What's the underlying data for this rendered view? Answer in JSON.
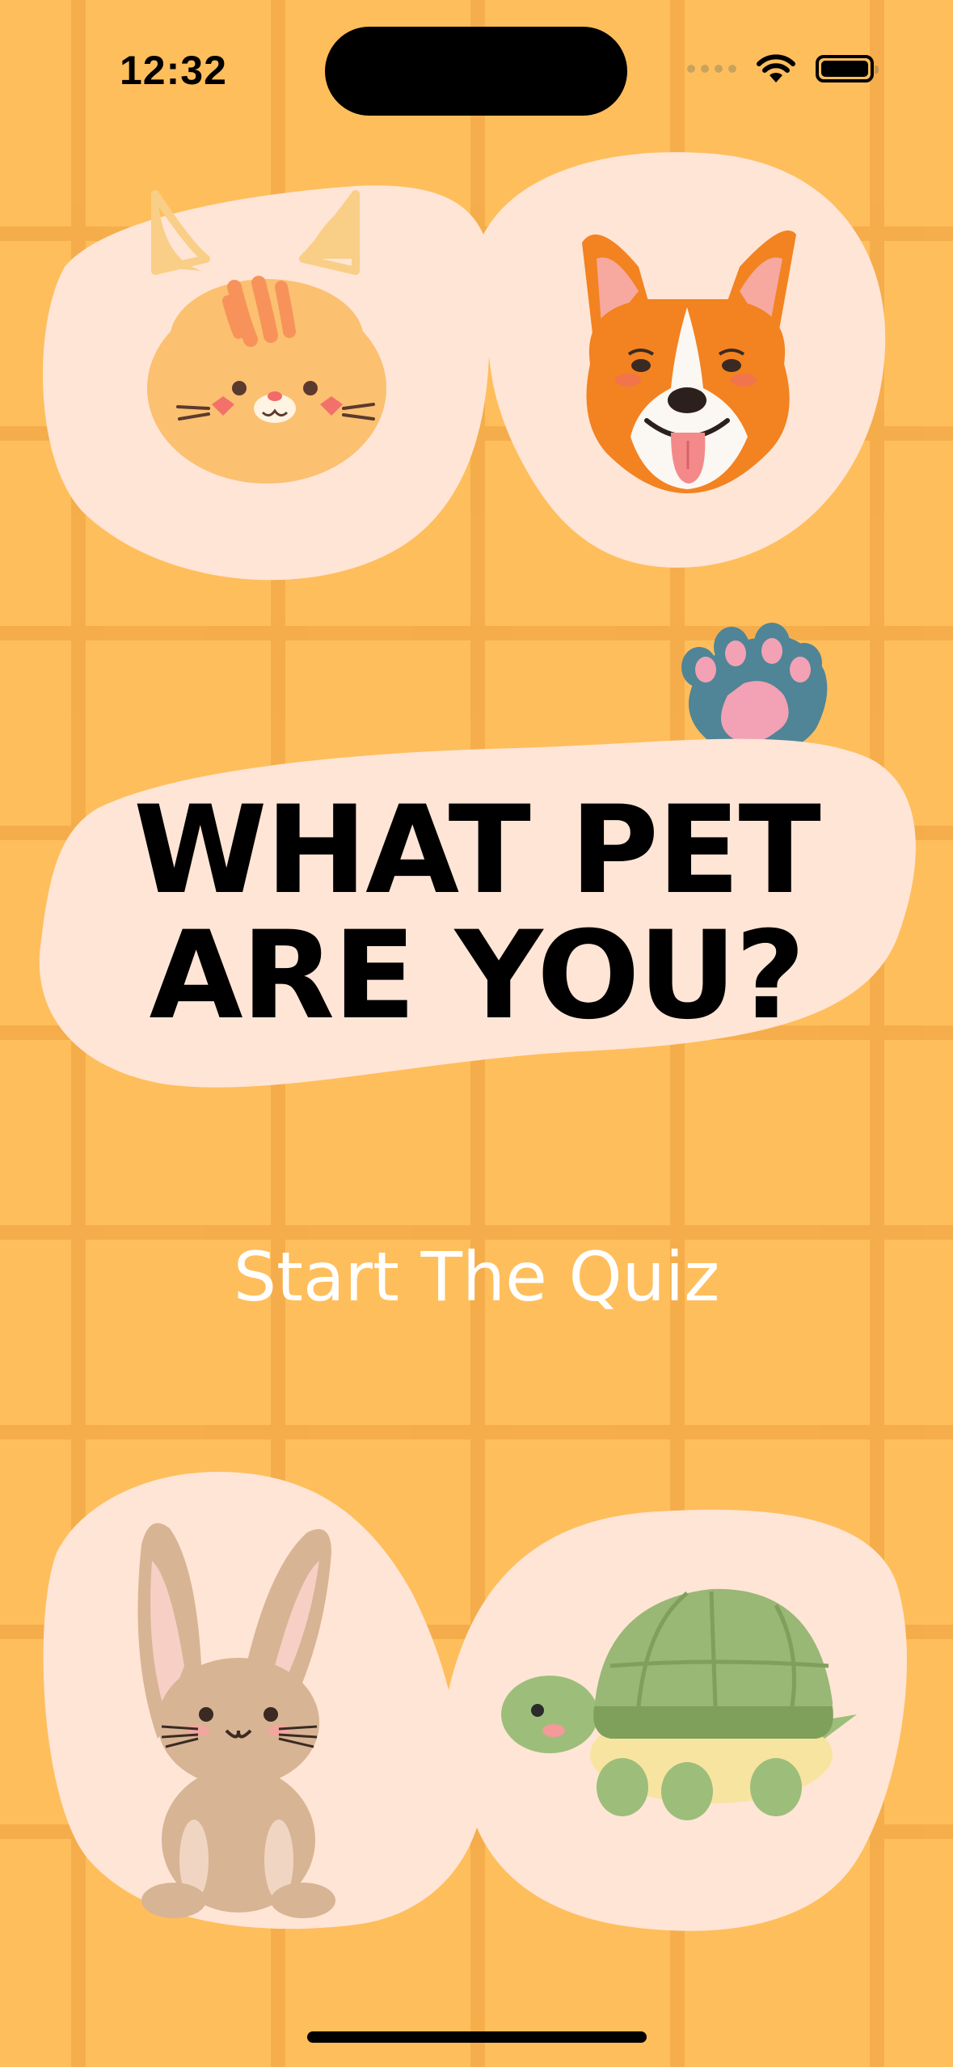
{
  "status_bar": {
    "time": "12:32",
    "icons": [
      "signal-dots-icon",
      "wifi-icon",
      "battery-icon"
    ]
  },
  "quiz": {
    "title_line1": "WHAT PET",
    "title_line2": "ARE YOU?",
    "cta_label": "Start The Quiz"
  },
  "illustrations": [
    "cat-icon",
    "corgi-dog-icon",
    "paw-print-icon",
    "rabbit-icon",
    "turtle-icon"
  ],
  "colors": {
    "background": "#FFBE5C",
    "grid_lines": "#F5AC4A",
    "blob": "#FFE5D6",
    "title_text": "#000000",
    "cta_text": "#FFFFFF"
  }
}
